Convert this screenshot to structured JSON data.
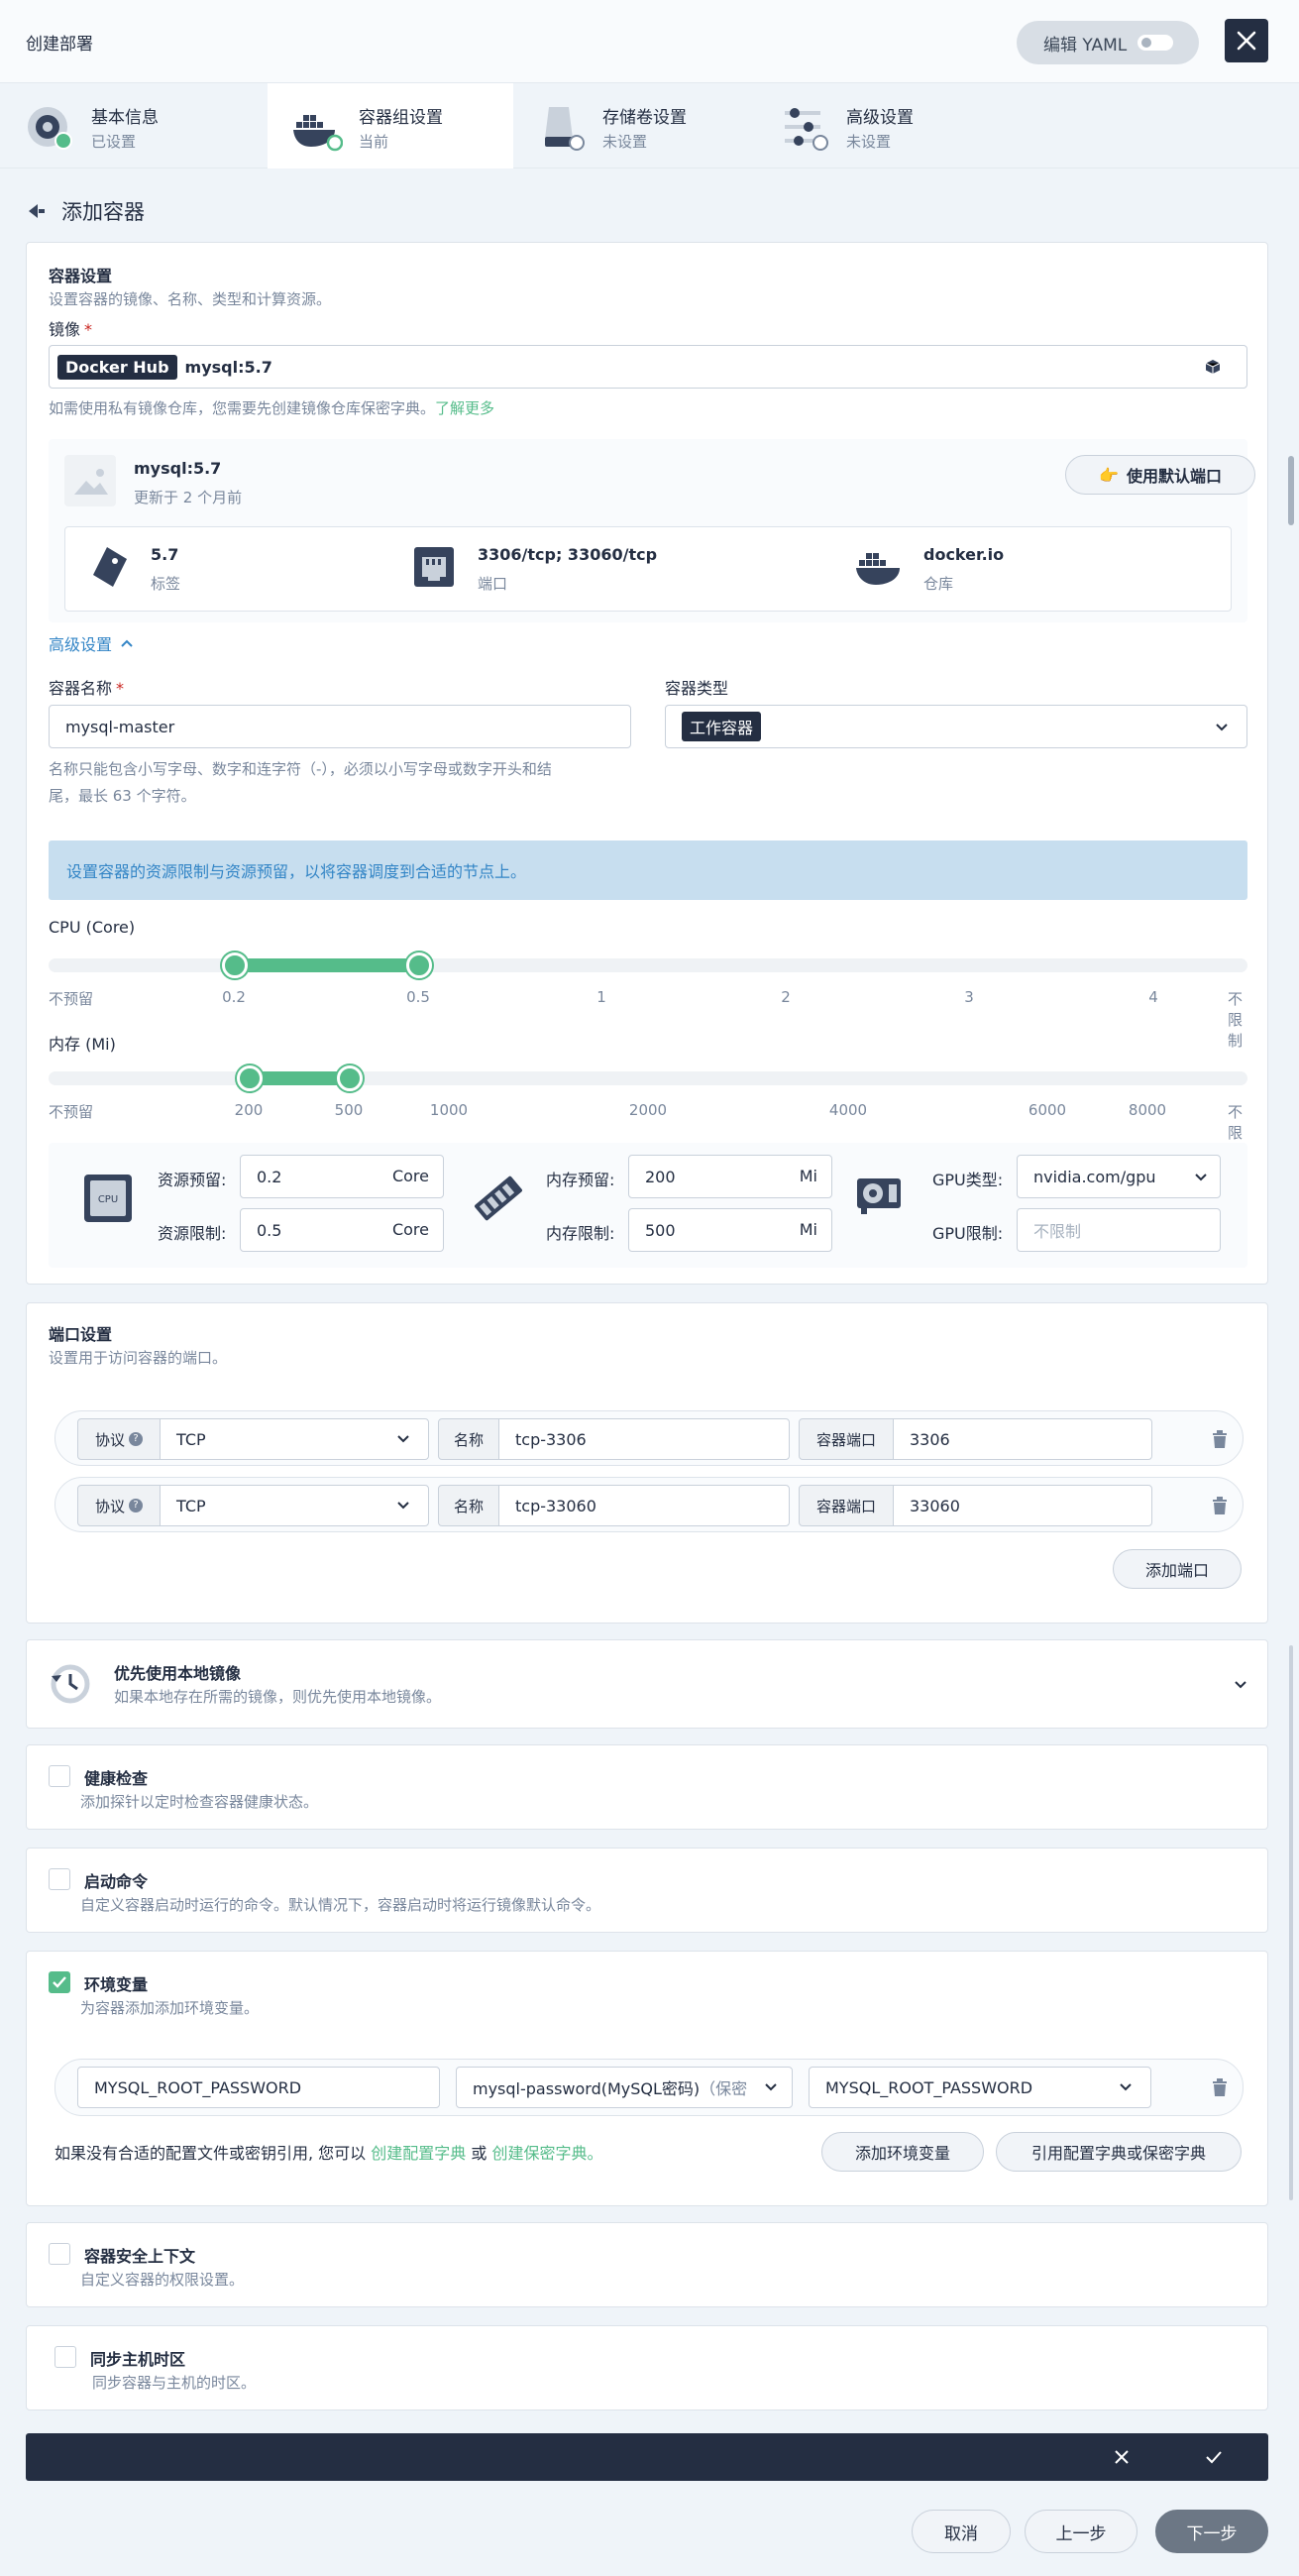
{
  "header": {
    "title": "创建部署",
    "yaml_label": "编辑 YAML"
  },
  "steps": [
    {
      "title": "基本信息",
      "status": "已设置"
    },
    {
      "title": "容器组设置",
      "status": "当前"
    },
    {
      "title": "存储卷设置",
      "status": "未设置"
    },
    {
      "title": "高级设置",
      "status": "未设置"
    }
  ],
  "back_label": "添加容器",
  "container_settings": {
    "title": "容器设置",
    "desc": "设置容器的镜像、名称、类型和计算资源。",
    "image_label": "镜像",
    "registry_tag": "Docker Hub",
    "image_value": "mysql:5.7",
    "image_hint": "如需使用私有镜像仓库，您需要先创建镜像仓库保密字典。",
    "learn_more": "了解更多",
    "image_name": "mysql:5.7",
    "image_updated": "更新于 2 个月前",
    "default_port_btn": "使用默认端口",
    "tag_value": "5.7",
    "tag_label": "标签",
    "port_value": "3306/tcp; 33060/tcp",
    "port_label": "端口",
    "repo_value": "docker.io",
    "repo_label": "仓库",
    "advanced_label": "高级设置",
    "name_label": "容器名称",
    "name_value": "mysql-master",
    "name_hint_1": "名称只能包含小写字母、数字和连字符（-），必须以小写字母或数字开头和结",
    "name_hint_2": "尾，最长 63 个字符。",
    "type_label": "容器类型",
    "type_value": "工作容器",
    "resource_tip": "设置容器的资源限制与资源预留，以将容器调度到合适的节点上。",
    "cpu_label": "CPU (Core)",
    "cpu_ticks": [
      "不预留",
      "0.2",
      "0.5",
      "1",
      "2",
      "3",
      "4",
      "不限制"
    ],
    "cpu_reserve": 0.2,
    "cpu_limit": 0.5,
    "mem_label": "内存 (Mi)",
    "mem_ticks": [
      "不预留",
      "200",
      "500",
      "1000",
      "2000",
      "4000",
      "6000",
      "8000",
      "不限制"
    ],
    "mem_reserve": 200,
    "mem_limit": 500,
    "res_reserve_label": "资源预留:",
    "res_limit_label": "资源限制:",
    "cpu_reserve_value": "0.2",
    "cpu_limit_value": "0.5",
    "cpu_unit": "Core",
    "mem_reserve_label": "内存预留:",
    "mem_limit_label": "内存限制:",
    "mem_reserve_value": "200",
    "mem_limit_value": "500",
    "mem_unit": "Mi",
    "gpu_type_label": "GPU类型:",
    "gpu_type_value": "nvidia.com/gpu",
    "gpu_limit_label": "GPU限制:",
    "gpu_limit_placeholder": "不限制",
    "cpu_icon_text": "CPU"
  },
  "ports": {
    "title": "端口设置",
    "desc": "设置用于访问容器的端口。",
    "protocol_label": "协议",
    "name_label": "名称",
    "container_port_label": "容器端口",
    "rows": [
      {
        "protocol": "TCP",
        "name": "tcp-3306",
        "port": "3306"
      },
      {
        "protocol": "TCP",
        "name": "tcp-33060",
        "port": "33060"
      }
    ],
    "add_btn": "添加端口"
  },
  "local_image": {
    "title": "优先使用本地镜像",
    "desc": "如果本地存在所需的镜像，则优先使用本地镜像。"
  },
  "health": {
    "title": "健康检查",
    "desc": "添加探针以定时检查容器健康状态。"
  },
  "command": {
    "title": "启动命令",
    "desc": "自定义容器启动时运行的命令。默认情况下，容器启动时将运行镜像默认命令。"
  },
  "env": {
    "title": "环境变量",
    "desc": "为容器添加添加环境变量。",
    "key": "MYSQL_ROOT_PASSWORD",
    "secret": "mysql-password(MySQL密码)",
    "secret_suffix": "（保密",
    "secret_key": "MYSQL_ROOT_PASSWORD",
    "hint": "如果没有合适的配置文件或密钥引用, 您可以",
    "create_config": "创建配置字典",
    "or": "或",
    "create_secret": "创建保密字典。",
    "add_btn": "添加环境变量",
    "ref_btn": "引用配置字典或保密字典"
  },
  "security": {
    "title": "容器安全上下文",
    "desc": "自定义容器的权限设置。"
  },
  "timezone": {
    "title": "同步主机时区",
    "desc": "同步容器与主机的时区。"
  },
  "footer": {
    "cancel": "取消",
    "prev": "上一步",
    "next": "下一步"
  }
}
